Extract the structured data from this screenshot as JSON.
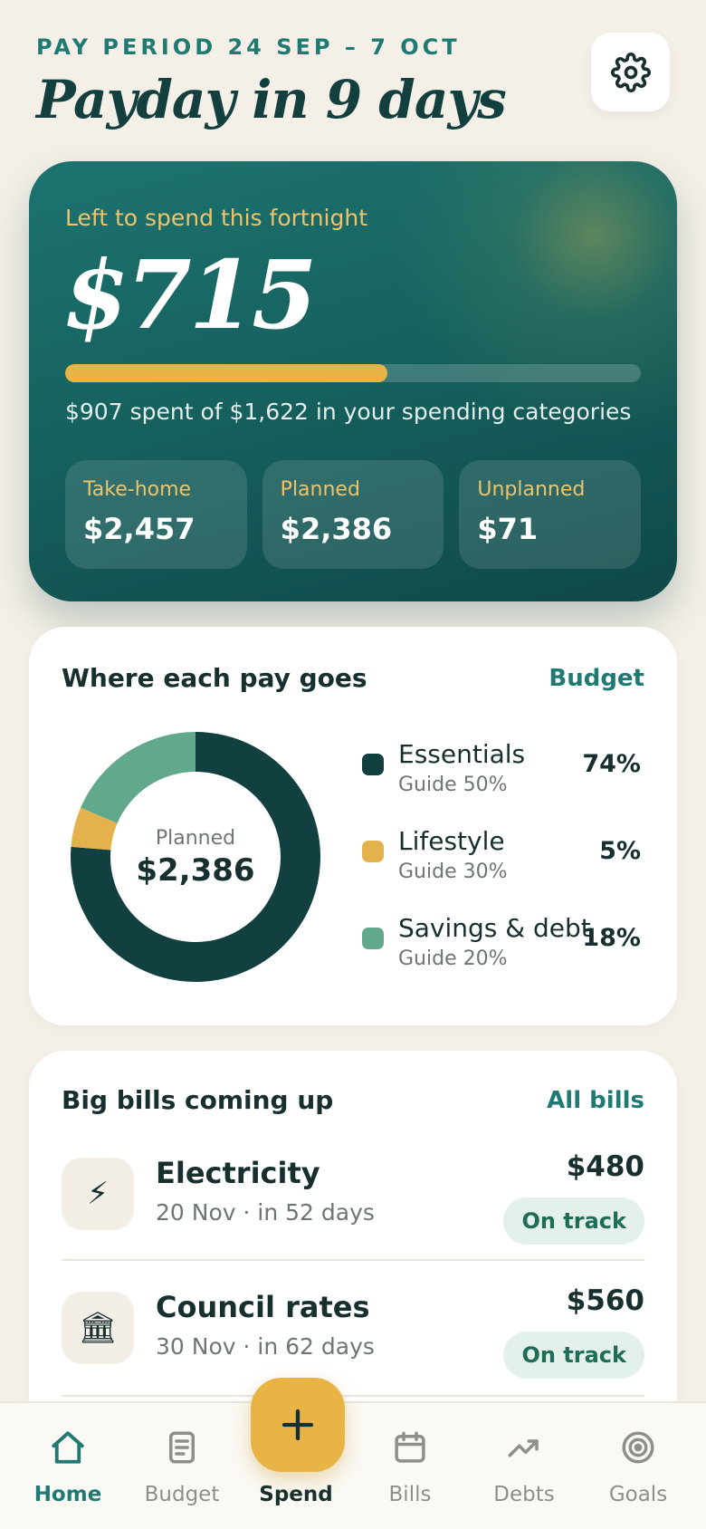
{
  "header": {
    "pay_period": "PAY PERIOD 24 SEP – 7 OCT",
    "title": "Payday in 9 days"
  },
  "hero": {
    "label": "Left to spend this fortnight",
    "amount": "$715",
    "progress_fraction": 0.559,
    "subtitle": "$907 spent of $1,622 in your spending categories",
    "stats": [
      {
        "label": "Take-home",
        "value": "$2,457"
      },
      {
        "label": "Planned",
        "value": "$2,386"
      },
      {
        "label": "Unplanned",
        "value": "$71"
      }
    ]
  },
  "allocation": {
    "title": "Where each pay goes",
    "link": "Budget",
    "center_label": "Planned",
    "center_value": "$2,386",
    "segments": [
      {
        "name": "Essentials",
        "guide": "Guide 50%",
        "pct_label": "74%",
        "pct": 74,
        "color": "#123f3f"
      },
      {
        "name": "Lifestyle",
        "guide": "Guide 30%",
        "pct_label": "5%",
        "pct": 5,
        "color": "#e3b24c"
      },
      {
        "name": "Savings & debt",
        "guide": "Guide 20%",
        "pct_label": "18%",
        "pct": 18,
        "color": "#62a98b"
      }
    ]
  },
  "bills": {
    "title": "Big bills coming up",
    "link": "All bills",
    "items": [
      {
        "icon": "⚡",
        "name": "Electricity",
        "date": "20 Nov · in 52 days",
        "amount": "$480",
        "status": "On track"
      },
      {
        "icon": "🏛",
        "name": "Council rates",
        "date": "30 Nov · in 62 days",
        "amount": "$560",
        "status": "On track"
      }
    ]
  },
  "nav": {
    "items": [
      {
        "label": "Home"
      },
      {
        "label": "Budget"
      },
      {
        "label": "Spend"
      },
      {
        "label": "Bills"
      },
      {
        "label": "Debts"
      },
      {
        "label": "Goals"
      }
    ],
    "fab_symbol": "+"
  },
  "colors": {
    "accent": "#1f7a73",
    "gold": "#e8b445",
    "dark": "#123f3f"
  }
}
